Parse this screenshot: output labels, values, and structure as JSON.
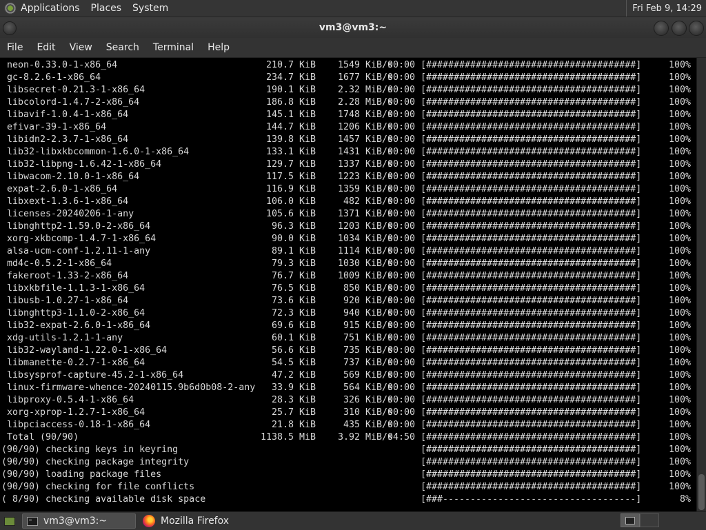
{
  "top_panel": {
    "menus": [
      "Applications",
      "Places",
      "System"
    ],
    "clock": "Fri Feb  9, 14:29"
  },
  "window": {
    "title": "vm3@vm3:~",
    "menu": [
      "File",
      "Edit",
      "View",
      "Search",
      "Terminal",
      "Help"
    ]
  },
  "terminal": {
    "downloads": [
      {
        "name": "neon-0.33.0-1-x86_64",
        "size": "210.7 KiB",
        "rate": "1549 KiB/s",
        "time": "00:00",
        "bar": "[######################################]",
        "pct": "100%"
      },
      {
        "name": "gc-8.2.6-1-x86_64",
        "size": "234.7 KiB",
        "rate": "1677 KiB/s",
        "time": "00:00",
        "bar": "[######################################]",
        "pct": "100%"
      },
      {
        "name": "libsecret-0.21.3-1-x86_64",
        "size": "190.1 KiB",
        "rate": "2.32 MiB/s",
        "time": "00:00",
        "bar": "[######################################]",
        "pct": "100%"
      },
      {
        "name": "libcolord-1.4.7-2-x86_64",
        "size": "186.8 KiB",
        "rate": "2.28 MiB/s",
        "time": "00:00",
        "bar": "[######################################]",
        "pct": "100%"
      },
      {
        "name": "libavif-1.0.4-1-x86_64",
        "size": "145.1 KiB",
        "rate": "1748 KiB/s",
        "time": "00:00",
        "bar": "[######################################]",
        "pct": "100%"
      },
      {
        "name": "efivar-39-1-x86_64",
        "size": "144.7 KiB",
        "rate": "1206 KiB/s",
        "time": "00:00",
        "bar": "[######################################]",
        "pct": "100%"
      },
      {
        "name": "libidn2-2.3.7-1-x86_64",
        "size": "139.8 KiB",
        "rate": "1457 KiB/s",
        "time": "00:00",
        "bar": "[######################################]",
        "pct": "100%"
      },
      {
        "name": "lib32-libxkbcommon-1.6.0-1-x86_64",
        "size": "133.1 KiB",
        "rate": "1431 KiB/s",
        "time": "00:00",
        "bar": "[######################################]",
        "pct": "100%"
      },
      {
        "name": "lib32-libpng-1.6.42-1-x86_64",
        "size": "129.7 KiB",
        "rate": "1337 KiB/s",
        "time": "00:00",
        "bar": "[######################################]",
        "pct": "100%"
      },
      {
        "name": "libwacom-2.10.0-1-x86_64",
        "size": "117.5 KiB",
        "rate": "1223 KiB/s",
        "time": "00:00",
        "bar": "[######################################]",
        "pct": "100%"
      },
      {
        "name": "expat-2.6.0-1-x86_64",
        "size": "116.9 KiB",
        "rate": "1359 KiB/s",
        "time": "00:00",
        "bar": "[######################################]",
        "pct": "100%"
      },
      {
        "name": "libxext-1.3.6-1-x86_64",
        "size": "106.0 KiB",
        "rate": "482 KiB/s",
        "time": "00:00",
        "bar": "[######################################]",
        "pct": "100%"
      },
      {
        "name": "licenses-20240206-1-any",
        "size": "105.6 KiB",
        "rate": "1371 KiB/s",
        "time": "00:00",
        "bar": "[######################################]",
        "pct": "100%"
      },
      {
        "name": "libnghttp2-1.59.0-2-x86_64",
        "size": "96.3 KiB",
        "rate": "1203 KiB/s",
        "time": "00:00",
        "bar": "[######################################]",
        "pct": "100%"
      },
      {
        "name": "xorg-xkbcomp-1.4.7-1-x86_64",
        "size": "90.0 KiB",
        "rate": "1034 KiB/s",
        "time": "00:00",
        "bar": "[######################################]",
        "pct": "100%"
      },
      {
        "name": "alsa-ucm-conf-1.2.11-1-any",
        "size": "89.1 KiB",
        "rate": "1114 KiB/s",
        "time": "00:00",
        "bar": "[######################################]",
        "pct": "100%"
      },
      {
        "name": "md4c-0.5.2-1-x86_64",
        "size": "79.3 KiB",
        "rate": "1030 KiB/s",
        "time": "00:00",
        "bar": "[######################################]",
        "pct": "100%"
      },
      {
        "name": "fakeroot-1.33-2-x86_64",
        "size": "76.7 KiB",
        "rate": "1009 KiB/s",
        "time": "00:00",
        "bar": "[######################################]",
        "pct": "100%"
      },
      {
        "name": "libxkbfile-1.1.3-1-x86_64",
        "size": "76.5 KiB",
        "rate": "850 KiB/s",
        "time": "00:00",
        "bar": "[######################################]",
        "pct": "100%"
      },
      {
        "name": "libusb-1.0.27-1-x86_64",
        "size": "73.6 KiB",
        "rate": "920 KiB/s",
        "time": "00:00",
        "bar": "[######################################]",
        "pct": "100%"
      },
      {
        "name": "libnghttp3-1.1.0-2-x86_64",
        "size": "72.3 KiB",
        "rate": "940 KiB/s",
        "time": "00:00",
        "bar": "[######################################]",
        "pct": "100%"
      },
      {
        "name": "lib32-expat-2.6.0-1-x86_64",
        "size": "69.6 KiB",
        "rate": "915 KiB/s",
        "time": "00:00",
        "bar": "[######################################]",
        "pct": "100%"
      },
      {
        "name": "xdg-utils-1.2.1-1-any",
        "size": "60.1 KiB",
        "rate": "751 KiB/s",
        "time": "00:00",
        "bar": "[######################################]",
        "pct": "100%"
      },
      {
        "name": "lib32-wayland-1.22.0-1-x86_64",
        "size": "56.6 KiB",
        "rate": "735 KiB/s",
        "time": "00:00",
        "bar": "[######################################]",
        "pct": "100%"
      },
      {
        "name": "libmanette-0.2.7-1-x86_64",
        "size": "54.5 KiB",
        "rate": "737 KiB/s",
        "time": "00:00",
        "bar": "[######################################]",
        "pct": "100%"
      },
      {
        "name": "libsysprof-capture-45.2-1-x86_64",
        "size": "47.2 KiB",
        "rate": "569 KiB/s",
        "time": "00:00",
        "bar": "[######################################]",
        "pct": "100%"
      },
      {
        "name": "linux-firmware-whence-20240115.9b6d0b08-2-any",
        "size": "33.9 KiB",
        "rate": "564 KiB/s",
        "time": "00:00",
        "bar": "[######################################]",
        "pct": "100%"
      },
      {
        "name": "libproxy-0.5.4-1-x86_64",
        "size": "28.3 KiB",
        "rate": "326 KiB/s",
        "time": "00:00",
        "bar": "[######################################]",
        "pct": "100%"
      },
      {
        "name": "xorg-xprop-1.2.7-1-x86_64",
        "size": "25.7 KiB",
        "rate": "310 KiB/s",
        "time": "00:00",
        "bar": "[######################################]",
        "pct": "100%"
      },
      {
        "name": "libpciaccess-0.18-1-x86_64",
        "size": "21.8 KiB",
        "rate": "435 KiB/s",
        "time": "00:00",
        "bar": "[######################################]",
        "pct": "100%"
      },
      {
        "name": "Total (90/90)",
        "size": "1138.5 MiB",
        "rate": "3.92 MiB/s",
        "time": "04:50",
        "bar": "[######################################]",
        "pct": "100%"
      }
    ],
    "checks": [
      {
        "text": "(90/90) checking keys in keyring",
        "bar": "[######################################]",
        "pct": "100%"
      },
      {
        "text": "(90/90) checking package integrity",
        "bar": "[######################################]",
        "pct": "100%"
      },
      {
        "text": "(90/90) loading package files",
        "bar": "[######################################]",
        "pct": "100%"
      },
      {
        "text": "(90/90) checking for file conflicts",
        "bar": "[######################################]",
        "pct": "100%"
      },
      {
        "text": "( 8/90) checking available disk space",
        "bar": "[###-----------------------------------]",
        "pct": "8%"
      }
    ]
  },
  "taskbar": {
    "tasks": [
      {
        "label": "vm3@vm3:~",
        "icon": "terminal-icon",
        "active": true
      },
      {
        "label": "Mozilla Firefox",
        "icon": "firefox-icon",
        "active": false
      }
    ]
  }
}
